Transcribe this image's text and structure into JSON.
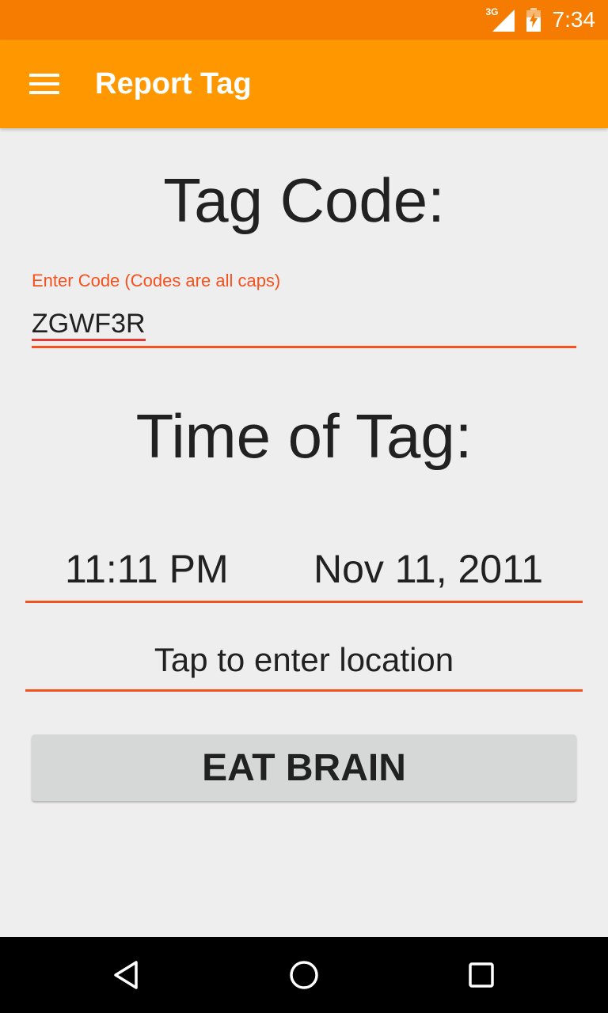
{
  "status_bar": {
    "network": "3G",
    "time": "7:34",
    "icons": [
      "signal-icon",
      "battery-icon"
    ]
  },
  "app_bar": {
    "title": "Report Tag",
    "menu_icon": "hamburger-menu-icon",
    "color": "#ff9800"
  },
  "form": {
    "tag_heading": "Tag Code:",
    "code_field": {
      "label": "Enter Code (Codes are all caps)",
      "value": "ZGWF3R"
    },
    "time_heading": "Time of Tag:",
    "time": "11:11 PM",
    "date": "Nov 11, 2011",
    "location_prompt": "Tap to enter location",
    "submit_label": "EAT BRAIN"
  },
  "colors": {
    "status_bar": "#f57c00",
    "accent": "#f4511e",
    "background": "#eeeeee",
    "button": "#d6d7d7"
  },
  "nav_bar": {
    "icons": [
      "back-icon",
      "home-icon",
      "recent-apps-icon"
    ]
  }
}
